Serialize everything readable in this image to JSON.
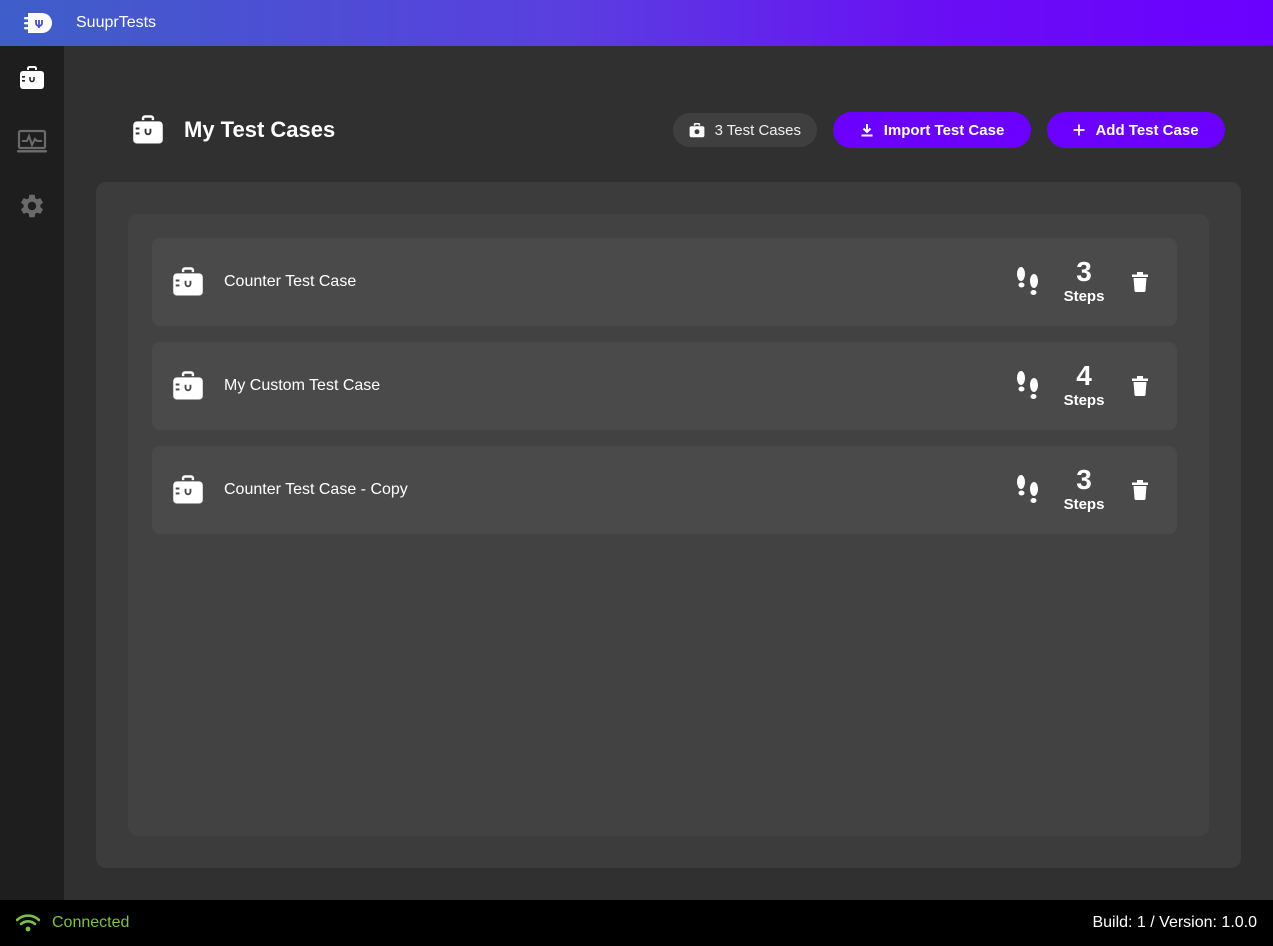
{
  "app": {
    "title": "SuuprTests"
  },
  "sidebar": {
    "items": [
      {
        "name": "test-cases",
        "icon": "briefcase-icon",
        "active": true
      },
      {
        "name": "monitor",
        "icon": "monitor-icon",
        "active": false
      },
      {
        "name": "settings",
        "icon": "gear-icon",
        "active": false
      }
    ]
  },
  "header": {
    "title": "My Test Cases",
    "count_label": "3 Test Cases",
    "import_label": "Import Test Case",
    "add_label": "Add Test Case"
  },
  "test_cases": [
    {
      "name": "Counter Test Case",
      "steps": "3",
      "steps_label": "Steps"
    },
    {
      "name": "My Custom Test Case",
      "steps": "4",
      "steps_label": "Steps"
    },
    {
      "name": "Counter Test Case - Copy",
      "steps": "3",
      "steps_label": "Steps"
    }
  ],
  "status": {
    "connection": "Connected",
    "version": "Build: 1 / Version: 1.0.0"
  },
  "colors": {
    "accent": "#6b00ff",
    "connected": "#7bc142",
    "main_bg": "#303030",
    "sidebar_bg": "#1e1e1e"
  }
}
